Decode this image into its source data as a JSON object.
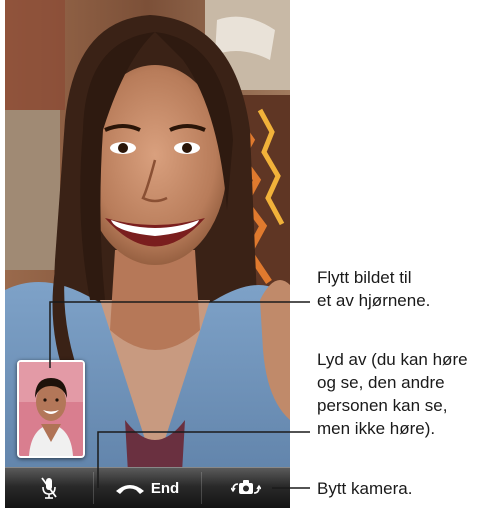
{
  "toolbar": {
    "mute_icon": "mic-muted-icon",
    "end_icon": "phone-hangup-icon",
    "end_label": "End",
    "switch_icon": "camera-switch-icon"
  },
  "callouts": {
    "move_pip": "Flytt bildet til\net av hjørnene.",
    "mute": "Lyd av (du kan høre\nog se, den andre\npersonen kan se,\nmen ikke høre).",
    "switch_camera": "Bytt kamera."
  },
  "colors": {
    "end_accent": "#ffffff",
    "pip_background": "#d97e8f",
    "callout_line": "#1a1a1a"
  }
}
